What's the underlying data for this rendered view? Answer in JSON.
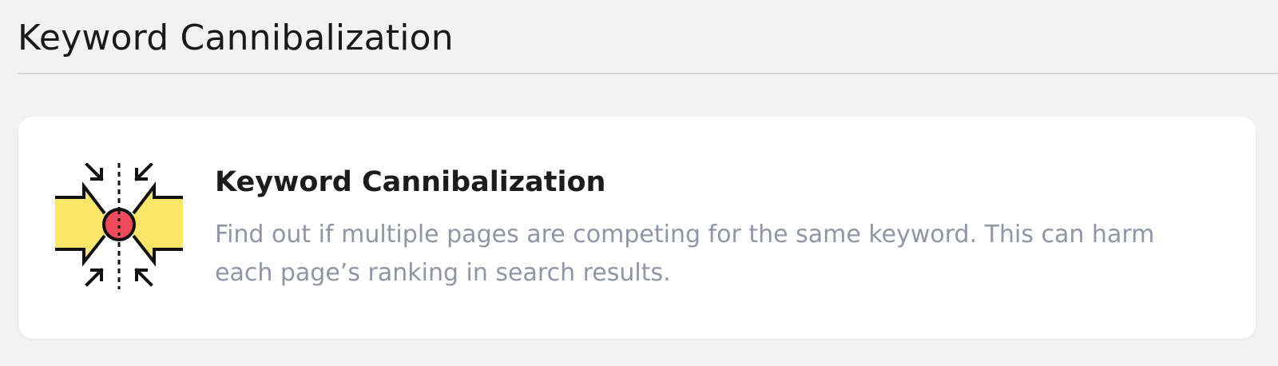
{
  "header": {
    "title": "Keyword Cannibalization"
  },
  "card": {
    "title": "Keyword Cannibalization",
    "description": "Find out if multiple pages are competing for the same keyword. This can harm each page’s ranking in search results.",
    "icon": "converging-arrows-target-icon"
  },
  "colors": {
    "background": "#f2f2f2",
    "card": "#ffffff",
    "icon_yellow": "#fae76a",
    "icon_red": "#ef4a5c",
    "description": "#8f96a6",
    "divider": "#d4d4d4"
  }
}
